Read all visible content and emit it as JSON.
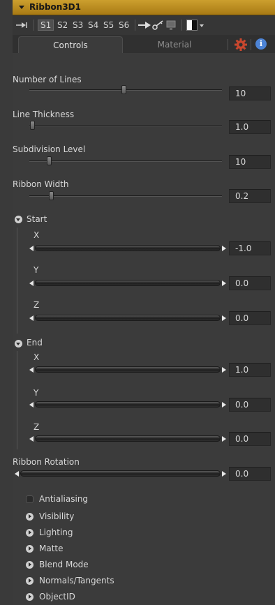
{
  "title": "Ribbon3D1",
  "toolbar": {
    "slots": [
      "S1",
      "S2",
      "S3",
      "S4",
      "S5",
      "S6"
    ],
    "active_slot": "S1"
  },
  "tabs": {
    "controls": "Controls",
    "material": "Material",
    "info_glyph": "i"
  },
  "params": {
    "number_of_lines": {
      "label": "Number of Lines",
      "value": "10",
      "slider_level": 0.5
    },
    "line_thickness": {
      "label": "Line Thickness",
      "value": "1.0",
      "slider_level": 0.0
    },
    "subdivision_level": {
      "label": "Subdivision Level",
      "value": "10",
      "slider_level": 0.1
    },
    "ribbon_width": {
      "label": "Ribbon Width",
      "value": "0.2",
      "slider_level": 0.1
    }
  },
  "start": {
    "label": "Start",
    "x": {
      "label": "X",
      "value": "-1.0"
    },
    "y": {
      "label": "Y",
      "value": "0.0"
    },
    "z": {
      "label": "Z",
      "value": "0.0"
    }
  },
  "end": {
    "label": "End",
    "x": {
      "label": "X",
      "value": "1.0"
    },
    "y": {
      "label": "Y",
      "value": "0.0"
    },
    "z": {
      "label": "Z",
      "value": "0.0"
    }
  },
  "ribbon_rotation": {
    "label": "Ribbon Rotation",
    "value": "0.0"
  },
  "options": {
    "antialiasing": "Antialiasing",
    "sections": [
      "Visibility",
      "Lighting",
      "Matte",
      "Blend Mode",
      "Normals/Tangents",
      "ObjectID"
    ]
  },
  "colors": {
    "title_bar": "#c4961f",
    "info_icon": "#4d84d6",
    "gear_icon": "#c8472e"
  }
}
